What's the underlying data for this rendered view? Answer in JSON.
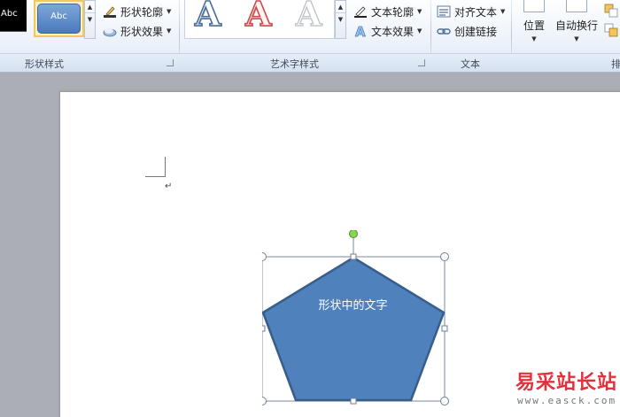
{
  "ribbon": {
    "shape_styles": {
      "group_label": "形状样式",
      "swatches": [
        {
          "label": "Abc"
        },
        {
          "label": "Abc"
        }
      ],
      "outline_label": "形状轮廓",
      "effects_label": "形状效果"
    },
    "wordart_styles": {
      "group_label": "艺术字样式",
      "samples": [
        "A",
        "A",
        "A"
      ],
      "text_outline_label": "文本轮廓",
      "text_effects_label": "文本效果"
    },
    "text": {
      "group_label": "文本",
      "align_text_label": "对齐文本",
      "create_link_label": "创建链接"
    },
    "arrange": {
      "group_label": "排",
      "position_label": "位置",
      "wrap_text_label": "自动换行"
    }
  },
  "document": {
    "shape": {
      "type": "pentagon",
      "text": "形状中的文字",
      "fill": "#4f81bd",
      "stroke": "#385d8a"
    }
  },
  "watermark": {
    "name": "易采站长站",
    "url": "www.easck.com"
  },
  "colors": {
    "ribbon_bg": "#eef3fa",
    "canvas_bg": "#abafb5",
    "selection_handle": "#ffffff",
    "rotate_handle": "#7cd74a"
  }
}
